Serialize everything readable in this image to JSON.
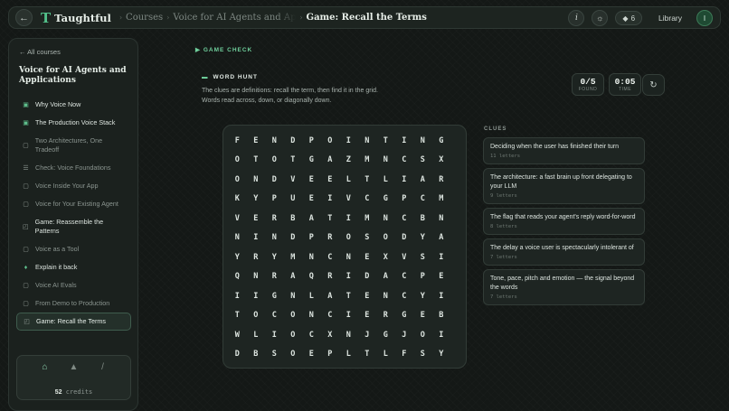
{
  "header": {
    "back_icon": "arrow-left-icon",
    "logo_glyph": "T",
    "app_name": "Taughtful",
    "breadcrumbs": [
      "Courses",
      "Voice for AI Agents and Applications",
      "Game: Recall the Terms"
    ],
    "info_label": "i",
    "credits_count": "6",
    "library_label": "Library",
    "avatar_initial": "I"
  },
  "sidebar": {
    "all_courses": "← All courses",
    "course_title": "Voice for AI Agents and Applications",
    "items": [
      {
        "label": "Why Voice Now",
        "icon": "lesson-done-icon",
        "state": "done"
      },
      {
        "label": "The Production Voice Stack",
        "icon": "lesson-done-icon",
        "state": "done"
      },
      {
        "label": "Two Architectures, One Tradeoff",
        "icon": "lesson-icon",
        "state": "muted"
      },
      {
        "label": "Check: Voice Foundations",
        "icon": "check-list-icon",
        "state": "muted"
      },
      {
        "label": "Voice Inside Your App",
        "icon": "lesson-icon",
        "state": "muted"
      },
      {
        "label": "Voice for Your Existing Agent",
        "icon": "lesson-icon",
        "state": "muted"
      },
      {
        "label": "Game: Reassemble the Patterns",
        "icon": "game-icon",
        "state": "done"
      },
      {
        "label": "Voice as a Tool",
        "icon": "lesson-icon",
        "state": "muted"
      },
      {
        "label": "Explain it back",
        "icon": "microphone-icon",
        "state": "done"
      },
      {
        "label": "Voice AI Evals",
        "icon": "lesson-icon",
        "state": "muted"
      },
      {
        "label": "From Demo to Production",
        "icon": "lesson-icon",
        "state": "muted"
      },
      {
        "label": "Game: Recall the Terms",
        "icon": "game-icon",
        "state": "active"
      }
    ],
    "credits": {
      "amount": "52",
      "label": "credits"
    }
  },
  "game": {
    "section_label": "GAME CHECK",
    "title": "WORD HUNT",
    "description_line1": "The clues are definitions: recall the term, then find it in the grid.",
    "description_line2": "Words read across, down, or diagonally down.",
    "found_value": "0/5",
    "found_label": "FOUND",
    "time_value": "0:05",
    "time_label": "TIME",
    "grid": [
      [
        "F",
        "E",
        "N",
        "D",
        "P",
        "O",
        "I",
        "N",
        "T",
        "I",
        "N",
        "G"
      ],
      [
        "O",
        "T",
        "O",
        "T",
        "G",
        "A",
        "Z",
        "M",
        "N",
        "C",
        "S",
        "X"
      ],
      [
        "O",
        "N",
        "D",
        "V",
        "E",
        "E",
        "L",
        "T",
        "L",
        "I",
        "A",
        "R"
      ],
      [
        "K",
        "Y",
        "P",
        "U",
        "E",
        "I",
        "V",
        "C",
        "G",
        "P",
        "C",
        "M"
      ],
      [
        "V",
        "E",
        "R",
        "B",
        "A",
        "T",
        "I",
        "M",
        "N",
        "C",
        "B",
        "N"
      ],
      [
        "N",
        "I",
        "N",
        "D",
        "P",
        "R",
        "O",
        "S",
        "O",
        "D",
        "Y",
        "A"
      ],
      [
        "Y",
        "R",
        "Y",
        "M",
        "N",
        "C",
        "N",
        "E",
        "X",
        "V",
        "S",
        "I"
      ],
      [
        "Q",
        "N",
        "R",
        "A",
        "Q",
        "R",
        "I",
        "D",
        "A",
        "C",
        "P",
        "E"
      ],
      [
        "I",
        "I",
        "G",
        "N",
        "L",
        "A",
        "T",
        "E",
        "N",
        "C",
        "Y",
        "I"
      ],
      [
        "T",
        "O",
        "C",
        "O",
        "N",
        "C",
        "I",
        "E",
        "R",
        "G",
        "E",
        "B"
      ],
      [
        "W",
        "L",
        "I",
        "O",
        "C",
        "X",
        "N",
        "J",
        "G",
        "J",
        "O",
        "I"
      ],
      [
        "D",
        "B",
        "S",
        "O",
        "E",
        "P",
        "L",
        "T",
        "L",
        "F",
        "S",
        "Y"
      ]
    ],
    "clues_title": "CLUES",
    "clues": [
      {
        "text": "Deciding when the user has finished their turn",
        "meta": "11 letters"
      },
      {
        "text": "The architecture: a fast brain up front delegating to your LLM",
        "meta": "9 letters"
      },
      {
        "text": "The flag that reads your agent's reply word-for-word",
        "meta": "8 letters"
      },
      {
        "text": "The delay a voice user is spectacularly intolerant of",
        "meta": "7 letters"
      },
      {
        "text": "Tone, pace, pitch and emotion — the signal beyond the words",
        "meta": "7 letters"
      }
    ]
  }
}
